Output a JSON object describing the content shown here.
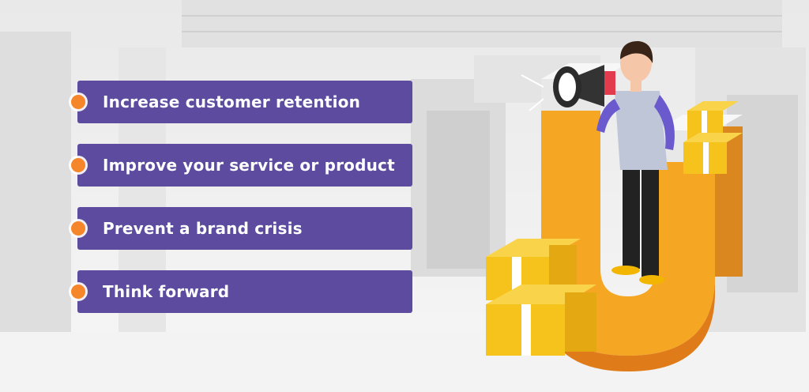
{
  "colors": {
    "bar": "#5c4b9f",
    "bullet": "#f5862a",
    "magnet": "#f5a623"
  },
  "list": [
    {
      "label": "Increase customer retention"
    },
    {
      "label": "Improve your service or product"
    },
    {
      "label": "Prevent a brand crisis"
    },
    {
      "label": "Think forward"
    }
  ],
  "illustration": {
    "icons": [
      "megaphone-icon",
      "magnet-icon",
      "gift-box-icon",
      "person-icon"
    ]
  }
}
